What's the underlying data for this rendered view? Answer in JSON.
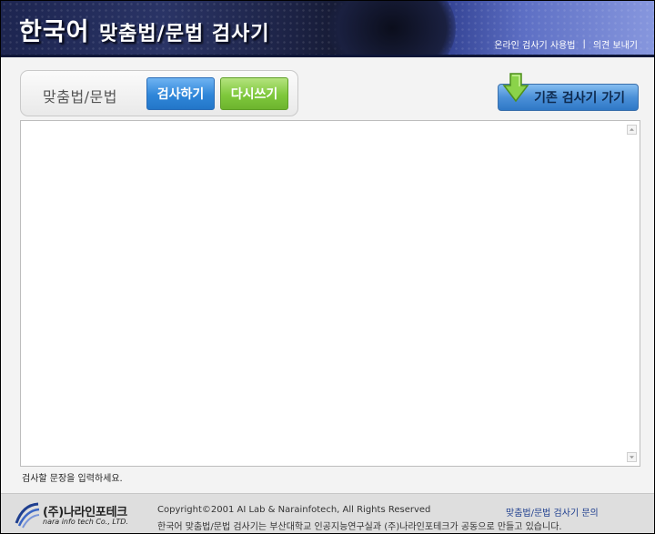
{
  "header": {
    "title_prefix": "한국어",
    "title_suffix": "맞춤법/문법 검사기",
    "links": [
      "온라인 검사기 사용법",
      "의견 보내기"
    ],
    "separator": "|"
  },
  "controls": {
    "label": "맞춤법/문법",
    "check_button": "검사하기",
    "reset_button": "다시쓰기",
    "old_checker_button": "기존 검사기 가기"
  },
  "editor": {
    "value": "",
    "hint": "검사할 문장을 입력하세요."
  },
  "footer": {
    "logo_text": "(주)나라인포테크",
    "logo_sub": "nara info tech Co., LTD.",
    "copyright": "Copyright©2001 AI Lab & Narainfotech, All Rights Reserved",
    "description": "한국어 맞춤법/문법 검사기는 부산대학교 인공지능연구실과 (주)나라인포테크가 공동으로 만들고 있습니다.",
    "inquiry": "맞춤법/문법 검사기 문의"
  },
  "colors": {
    "check_button": "#2f86d9",
    "reset_button": "#7fc83c",
    "old_checker_button": "#4b90d8",
    "header_dark": "#1c2244",
    "header_light": "#8797de"
  }
}
